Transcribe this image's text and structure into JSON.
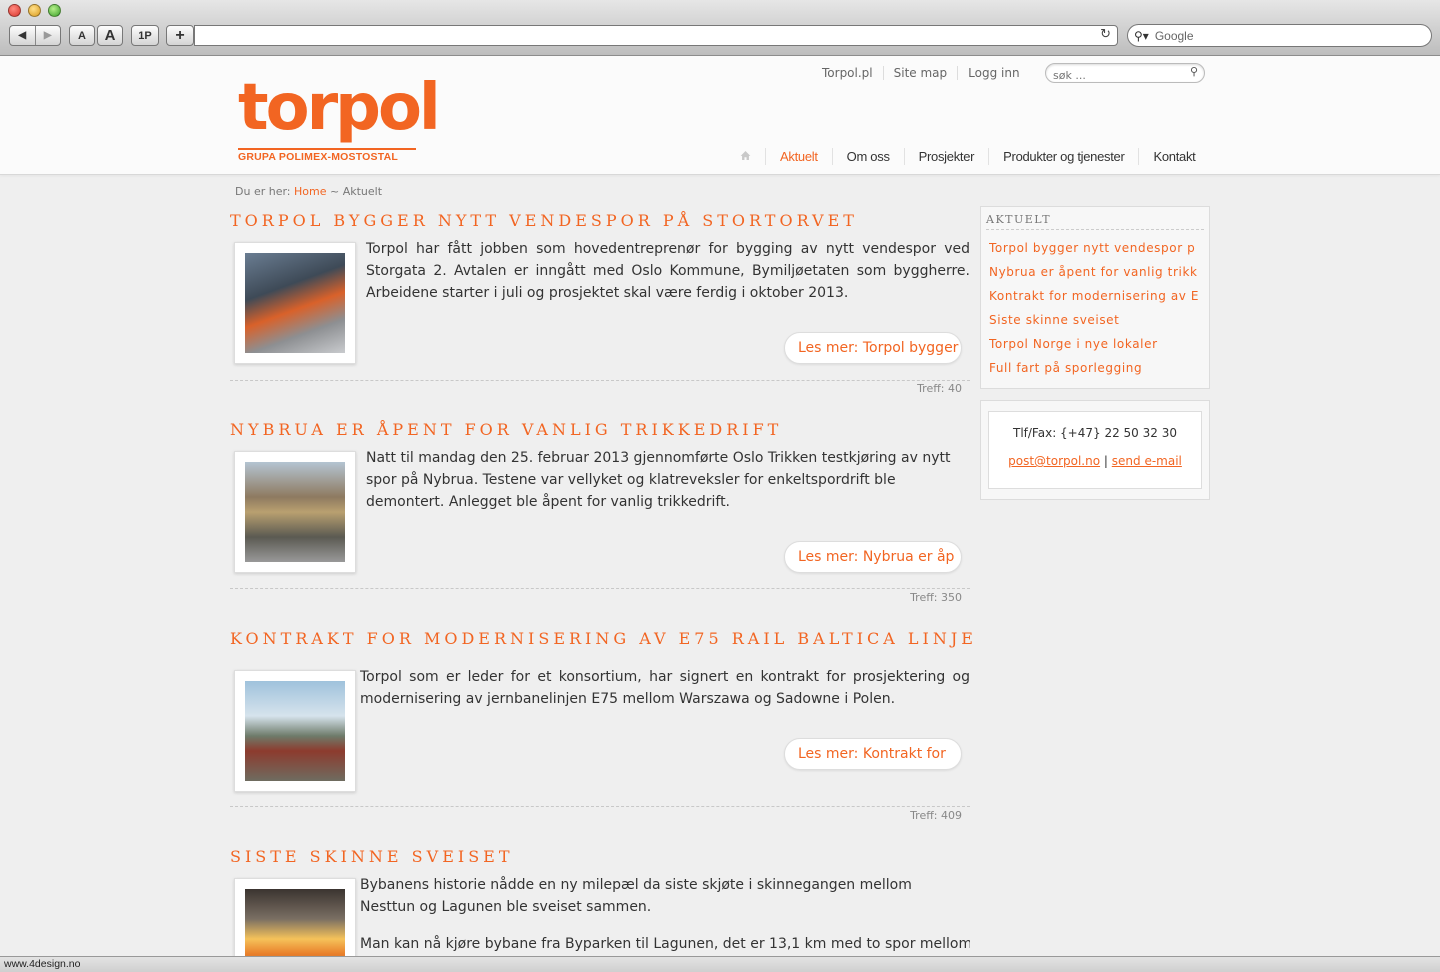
{
  "browser": {
    "nav_back": "◀",
    "nav_forward": "▶",
    "font_small": "A",
    "font_big": "A",
    "onepassword": "1P",
    "add_bookmark": "+",
    "search_placeholder": "Google",
    "status_url": "www.4design.no"
  },
  "site": {
    "logo_word": "torpol",
    "logo_sub": "GRUPA POLIMEX-MOSTOSTAL",
    "brand_color": "#f26522",
    "top_links": [
      "Torpol.pl",
      "Site map",
      "Logg inn"
    ],
    "search_placeholder": "søk ...",
    "nav": [
      "Aktuelt",
      "Om oss",
      "Prosjekter",
      "Produkter og tjenester",
      "Kontakt"
    ],
    "breadcrumb_prefix": "Du er her:",
    "breadcrumb_home": "Home",
    "breadcrumb_current": "~ Aktuelt"
  },
  "articles": [
    {
      "title": "Torpol bygger nytt vendespor på Stortorvet",
      "text": "Torpol har fått jobben som hovedentreprenør for bygging av nytt vendespor ved Storgata 2. Avtalen er inngått med Oslo Kommune, Bymiljøetaten som byggherre. Arbeidene starter i juli og prosjektet skal være ferdig i oktober 2013.",
      "readmore": "Les mer: Torpol bygger",
      "hits": "Treff: 40"
    },
    {
      "title": "Nybrua er åpent for vanlig trikkedrift",
      "text": "Natt til mandag den 25. februar 2013 gjennomførte Oslo Trikken testkjøring av nytt spor på Nybrua. Testene var vellyket og klatreveksler for enkeltspordrift ble demontert. Anlegget ble åpent for vanlig trikkedrift.",
      "readmore": "Les mer: Nybrua er åp",
      "hits": "Treff: 350"
    },
    {
      "title": "Kontrakt for modernisering av E75 Rail Baltica linje",
      "text": "Torpol som er leder for et konsortium, har signert en kontrakt for prosjektering og modernisering av jernbanelinjen E75 mellom Warszawa og Sadowne i Polen.",
      "readmore": "Les mer: Kontrakt for",
      "hits": "Treff: 409"
    },
    {
      "title": "Siste skinne sveiset",
      "text": "Bybanens historie nådde en ny milepæl da siste skjøte i skinnegangen mellom Nesttun og Lagunen ble sveiset sammen.",
      "text2": "Man kan nå kjøre bybane fra Byparken til Lagunen, det er 13,1 km med to spor mellom"
    }
  ],
  "sidebar": {
    "title": "Aktuelt",
    "items": [
      "Torpol bygger nytt vendespor p",
      "Nybrua er åpent for vanlig trikk",
      "Kontrakt for modernisering av E",
      "Siste skinne sveiset",
      "Torpol Norge i nye lokaler",
      "Full fart på sporlegging"
    ],
    "phone": "Tlf/Fax: {+47} 22 50 32 30",
    "email": "post@torpol.no",
    "separator": "|",
    "send_email": "send e-mail"
  }
}
